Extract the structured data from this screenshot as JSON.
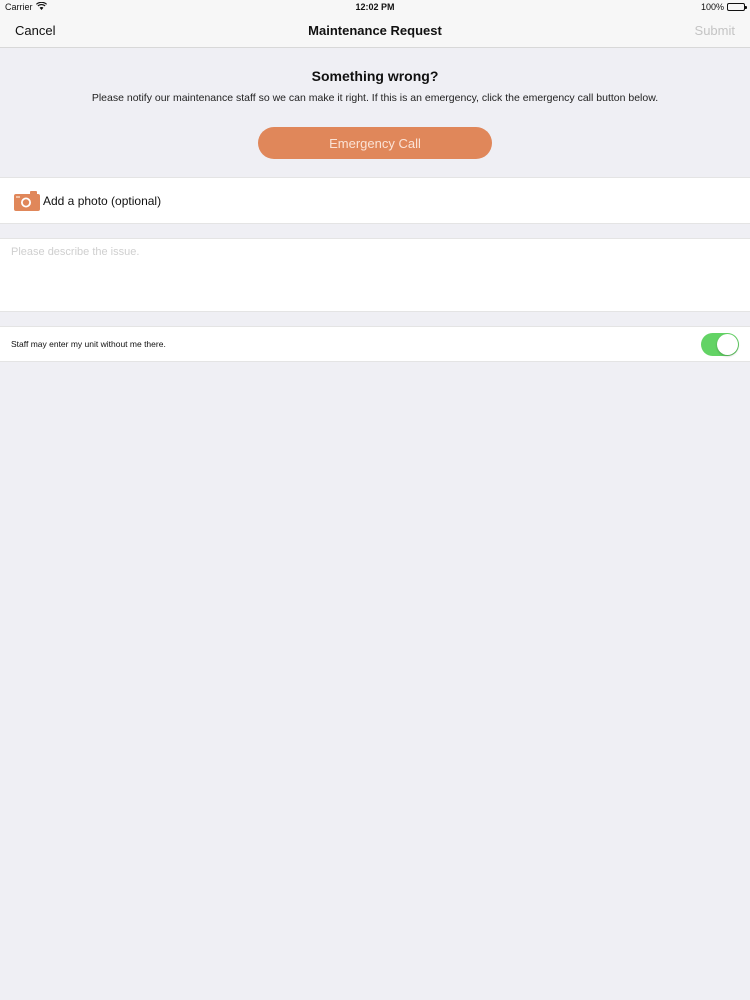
{
  "status_bar": {
    "carrier": "Carrier",
    "time": "12:02 PM",
    "battery": "100%"
  },
  "nav": {
    "cancel_label": "Cancel",
    "title": "Maintenance Request",
    "submit_label": "Submit"
  },
  "header": {
    "heading": "Something wrong?",
    "description": "Please notify our maintenance staff so we can make it right. If this is an emergency, click the emergency call button below.",
    "emergency_label": "Emergency Call"
  },
  "photo": {
    "label": "Add a photo (optional)",
    "icon": "camera-icon"
  },
  "issue": {
    "value": "",
    "placeholder": "Please describe the issue."
  },
  "permission": {
    "label": "Staff may enter my unit without me there.",
    "enabled": true
  },
  "colors": {
    "accent": "#e0875a",
    "toggle_on": "#63d365",
    "background": "#efeff4"
  }
}
